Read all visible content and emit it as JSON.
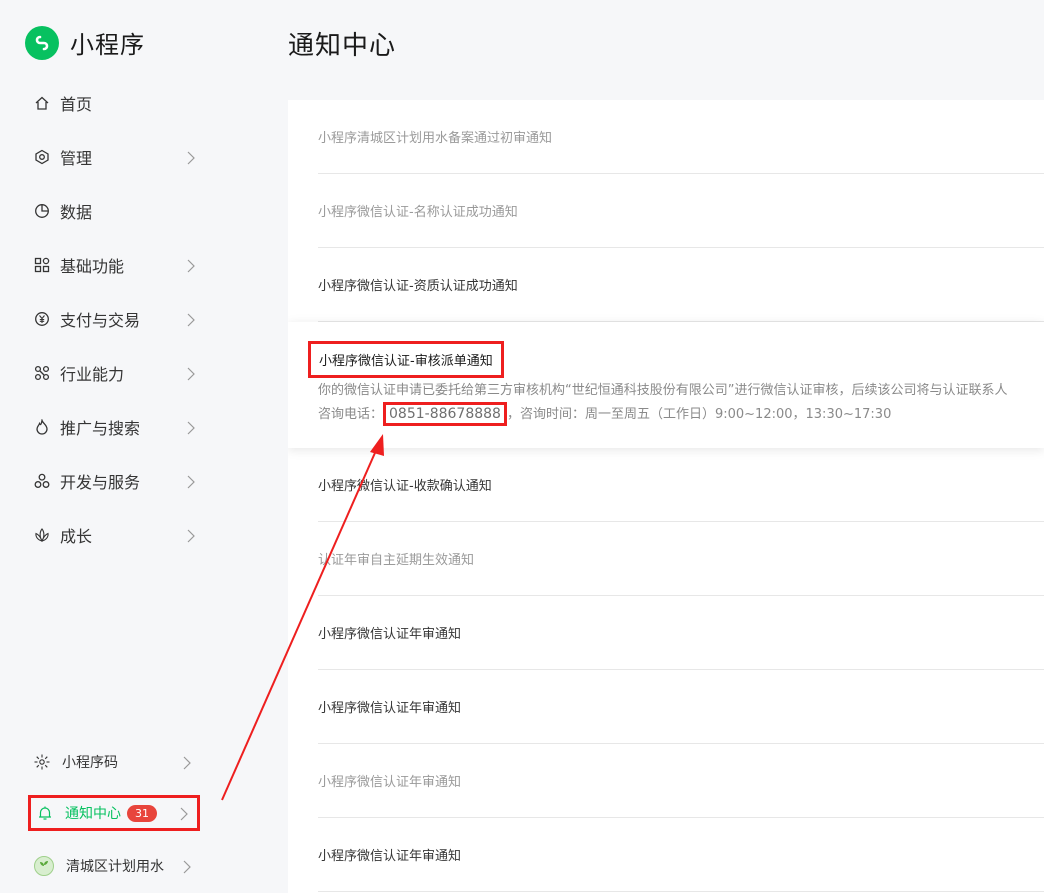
{
  "brand": {
    "name": "小程序",
    "logo_icon": "miniprogram-logo-icon",
    "accent": "#07c160"
  },
  "sidebar": {
    "items": [
      {
        "label": "首页",
        "icon": "home-icon",
        "has_arrow": false
      },
      {
        "label": "管理",
        "icon": "manage-icon",
        "has_arrow": true
      },
      {
        "label": "数据",
        "icon": "pie-chart-icon",
        "has_arrow": false
      },
      {
        "label": "基础功能",
        "icon": "grid-icon",
        "has_arrow": true
      },
      {
        "label": "支付与交易",
        "icon": "yuan-icon",
        "has_arrow": true
      },
      {
        "label": "行业能力",
        "icon": "industry-icon",
        "has_arrow": true
      },
      {
        "label": "推广与搜索",
        "icon": "flame-icon",
        "has_arrow": true
      },
      {
        "label": "开发与服务",
        "icon": "dev-icon",
        "has_arrow": true
      },
      {
        "label": "成长",
        "icon": "lotus-icon",
        "has_arrow": true
      }
    ],
    "bottom": [
      {
        "label": "小程序码",
        "icon": "qrcode-sun-icon"
      },
      {
        "label": "通知中心",
        "icon": "bell-icon",
        "badge": "31",
        "active": true
      },
      {
        "label": "清城区计划用水",
        "icon": "account-avatar"
      }
    ]
  },
  "main": {
    "title": "通知中心",
    "notifications": [
      {
        "title": "小程序清城区计划用水备案通过初审通知",
        "read": true
      },
      {
        "title": "小程序微信认证-名称认证成功通知",
        "read": true
      },
      {
        "title": "小程序微信认证-资质认证成功通知",
        "read": false
      },
      {
        "title": "小程序微信认证-审核派单通知",
        "read": false,
        "expanded": true,
        "body_line1": "你的微信认证申请已委托给第三方审核机构“世纪恒通科技股份有限公司”进行微信认证审核，后续该公司将与认证联系人",
        "phone_label": "咨询电话：",
        "phone": "0851-88678888",
        "hours": "，咨询时间：周一至周五（工作日）9:00~12:00，13:30~17:30"
      },
      {
        "title": "小程序微信认证-收款确认通知",
        "read": false
      },
      {
        "title": "认证年审自主延期生效通知",
        "read": true
      },
      {
        "title": "小程序微信认证年审通知",
        "read": false
      },
      {
        "title": "小程序微信认证年审通知",
        "read": false
      },
      {
        "title": "小程序微信认证年审通知",
        "read": true
      },
      {
        "title": "小程序微信认证年审通知",
        "read": false
      }
    ]
  },
  "annotation": {
    "color": "#ee1f1f"
  }
}
